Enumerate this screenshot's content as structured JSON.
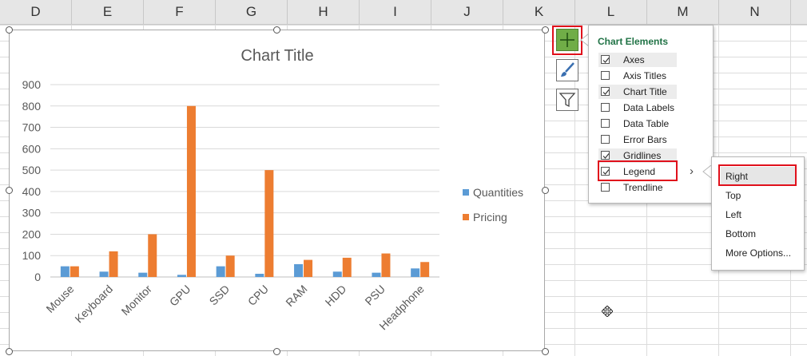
{
  "columns": [
    "D",
    "E",
    "F",
    "G",
    "H",
    "I",
    "J",
    "K",
    "L",
    "M",
    "N"
  ],
  "chart": {
    "title": "Chart Title",
    "series_colors": [
      "#5b9bd5",
      "#ed7d31"
    ]
  },
  "chart_data": {
    "type": "bar",
    "title": "Chart Title",
    "categories": [
      "Mouse",
      "Keyboard",
      "Monitor",
      "GPU",
      "SSD",
      "CPU",
      "RAM",
      "HDD",
      "PSU",
      "Headphone"
    ],
    "series": [
      {
        "name": "Quantities",
        "values": [
          50,
          25,
          20,
          10,
          50,
          15,
          60,
          25,
          20,
          40
        ]
      },
      {
        "name": "Pricing",
        "values": [
          50,
          120,
          200,
          800,
          100,
          500,
          80,
          90,
          110,
          70
        ]
      }
    ],
    "yticks": [
      "0",
      "100",
      "200",
      "300",
      "400",
      "500",
      "600",
      "700",
      "800",
      "900"
    ],
    "ylim": [
      0,
      900
    ],
    "grid": true,
    "legend": "right"
  },
  "side_buttons": {
    "elements": "plus-icon",
    "styles": "brush-icon",
    "filters": "funnel-icon"
  },
  "chart_elements_panel": {
    "title": "Chart Elements",
    "items": [
      {
        "label": "Axes",
        "checked": true
      },
      {
        "label": "Axis Titles",
        "checked": false
      },
      {
        "label": "Chart Title",
        "checked": true
      },
      {
        "label": "Data Labels",
        "checked": false
      },
      {
        "label": "Data Table",
        "checked": false
      },
      {
        "label": "Error Bars",
        "checked": false
      },
      {
        "label": "Gridlines",
        "checked": true
      },
      {
        "label": "Legend",
        "checked": true
      },
      {
        "label": "Trendline",
        "checked": false
      }
    ],
    "arrow": "›"
  },
  "legend_submenu": {
    "items": [
      "Right",
      "Top",
      "Left",
      "Bottom",
      "More Options..."
    ]
  },
  "colors": {
    "green_accent": "#217346",
    "highlight_red": "#e0101b",
    "button_green": "#70ad47"
  }
}
